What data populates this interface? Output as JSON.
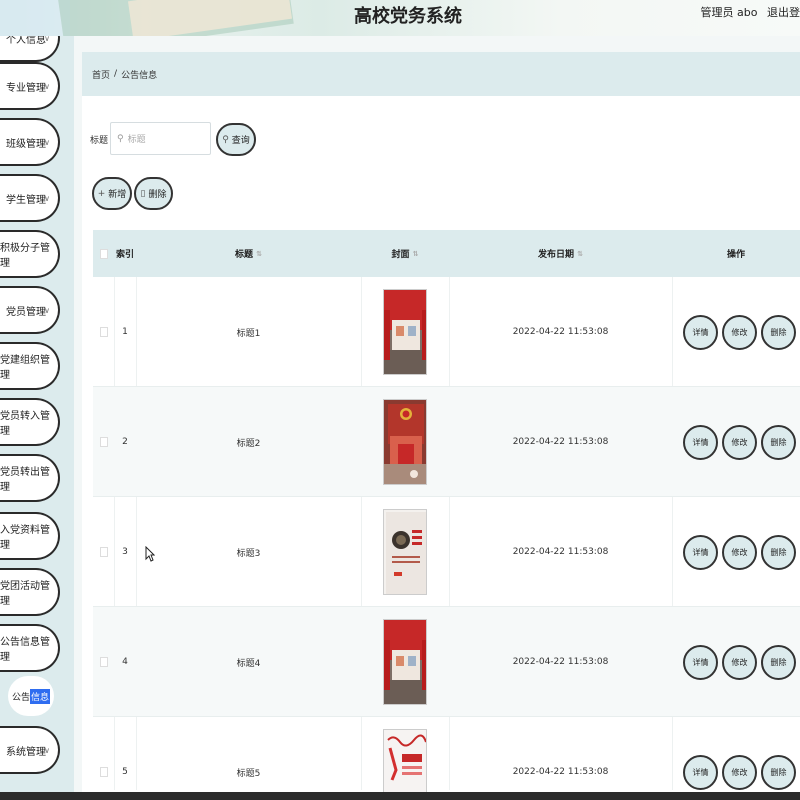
{
  "header": {
    "title": "高校党务系统",
    "user_label": "管理员 abo",
    "logout_label": "退出登"
  },
  "sidebar": {
    "items": [
      {
        "label": "个人信息",
        "has_arrow": true
      },
      {
        "label": "专业管理",
        "has_arrow": true
      },
      {
        "label": "班级管理",
        "has_arrow": true
      },
      {
        "label": "学生管理",
        "has_arrow": true
      },
      {
        "label": "积极分子管理",
        "has_arrow": false
      },
      {
        "label": "党员管理",
        "has_arrow": true
      },
      {
        "label": "党建组织管理",
        "has_arrow": false
      },
      {
        "label": "党员转入管理",
        "has_arrow": false
      },
      {
        "label": "党员转出管理",
        "has_arrow": false
      },
      {
        "label": "入党资料管理",
        "has_arrow": false
      },
      {
        "label": "党团活动管理",
        "has_arrow": false
      },
      {
        "label": "公告信息管理",
        "has_arrow": false
      },
      {
        "label": "系统管理",
        "has_arrow": true
      }
    ],
    "sub_item_prefix": "公告",
    "sub_item_highlight": "信息"
  },
  "breadcrumb": {
    "home": "首页",
    "separator": "/",
    "current": "公告信息"
  },
  "search": {
    "label": "标题",
    "placeholder": "标题",
    "query_button": "查询"
  },
  "toolbar": {
    "add_label": "新增",
    "delete_label": "删除"
  },
  "table": {
    "columns": {
      "index": "索引",
      "title": "标题",
      "cover": "封面",
      "date": "发布日期",
      "actions": "操作"
    },
    "rows": [
      {
        "index": "1",
        "title": "标题1",
        "date": "2022-04-22 11:53:08",
        "cover": "red-hall"
      },
      {
        "index": "2",
        "title": "标题2",
        "date": "2022-04-22 11:53:08",
        "cover": "party-emblem-hall"
      },
      {
        "index": "3",
        "title": "标题3",
        "date": "2022-04-22 11:53:08",
        "cover": "poster"
      },
      {
        "index": "4",
        "title": "标题4",
        "date": "2022-04-22 11:53:08",
        "cover": "red-hall"
      },
      {
        "index": "5",
        "title": "标题5",
        "date": "2022-04-22 11:53:08",
        "cover": "calligraphy"
      }
    ],
    "action_labels": {
      "detail": "详情",
      "edit": "修改",
      "delete": "删除"
    }
  },
  "colors": {
    "accent": "#dcebed",
    "highlight": "#2f6df0"
  }
}
